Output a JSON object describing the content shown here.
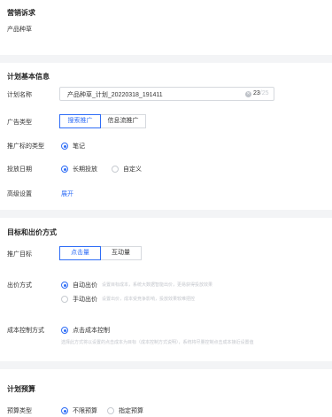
{
  "marketing": {
    "title": "营销诉求",
    "product_type": "产品种草"
  },
  "plan_info": {
    "title": "计划基本信息",
    "name_label": "计划名称",
    "name_value": "产品种草_计划_20220318_191411",
    "name_count": "23",
    "name_max": "/25",
    "ad_type_label": "广告类型",
    "ad_type_options": [
      "搜索推广",
      "信息流推广"
    ],
    "target_type_label": "推广标的类型",
    "target_type_option": "笔记",
    "date_label": "投放日期",
    "date_options": [
      "长期投放",
      "自定义"
    ],
    "advanced_label": "高级设置",
    "advanced_link": "展开"
  },
  "bidding": {
    "title": "目标和出价方式",
    "goal_label": "推广目标",
    "goal_options": [
      "点击量",
      "互动量"
    ],
    "bid_label": "出价方式",
    "bid_options": [
      {
        "label": "自动出价",
        "hint": "设置目标成本，系统大数据智能出价，更易获得投放效果"
      },
      {
        "label": "手动出价",
        "hint": "设置出价，成本受竞争影响，投放效果较难把控"
      }
    ],
    "cost_label": "成本控制方式",
    "cost_option": "点击成本控制",
    "cost_hint": "选择此方式将以设置的点击成本为目标（成本控制方式说明），系统将尽量控制点击成本接近设置值"
  },
  "budget": {
    "title": "计划预算",
    "type_label": "预算类型",
    "type_options": [
      "不限预算",
      "指定预算"
    ]
  },
  "colors": {
    "accent": "#2f6df6",
    "divider_bg": "#f3f4f6"
  }
}
